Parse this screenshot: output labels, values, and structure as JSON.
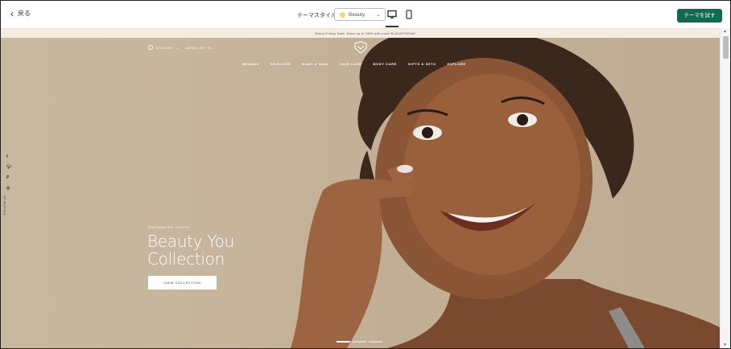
{
  "topbar": {
    "back_label": "戻る",
    "theme_style_label": "テーマスタイル",
    "theme_style_value": "Beauty",
    "try_button_label": "テーマを試す"
  },
  "announcement": {
    "text": "Black Friday Sale: Save up to 30% with code BLACKFRIDAY"
  },
  "store_header": {
    "language": "ENGLISH",
    "currency": "JAPAN (JPY ¥)",
    "nav": [
      "BRANDS",
      "SKINCARE",
      "BABY & KIDS",
      "HAIR CARE",
      "BODY CARE",
      "GIFTS & SETS",
      "EXPLORE"
    ]
  },
  "hero": {
    "eyebrow": "RADVANCED YOUTH",
    "title_line1": "Beauty You",
    "title_line2": "Collection",
    "cta_label": "VIEW COLLECTION",
    "follow_label": "FOLLOW US"
  },
  "social_icons": [
    "facebook-icon",
    "twitter-icon",
    "pinterest-icon",
    "instagram-icon"
  ],
  "colors": {
    "accent": "#0e6b4f",
    "announcement_bg": "#f3ecdf",
    "hero_bg": "#c6b59c"
  }
}
